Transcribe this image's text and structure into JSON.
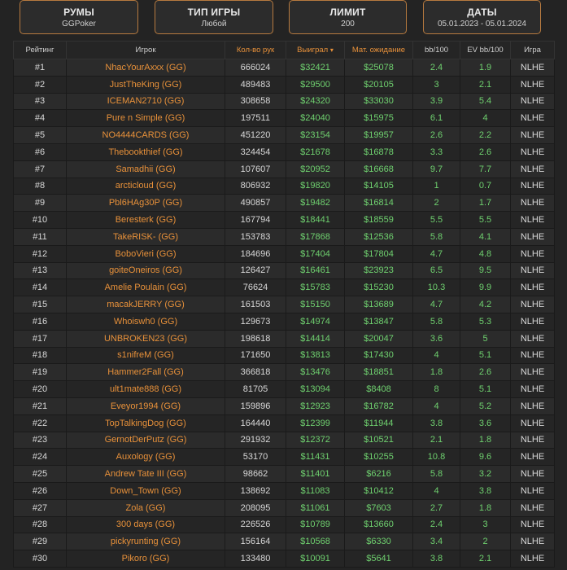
{
  "filters": [
    {
      "title": "РУМЫ",
      "value": "GGPoker"
    },
    {
      "title": "ТИП ИГРЫ",
      "value": "Любой"
    },
    {
      "title": "ЛИМИТ",
      "value": "200"
    },
    {
      "title": "ДАТЫ",
      "value": "05.01.2023 - 05.01.2024"
    }
  ],
  "table": {
    "headers": {
      "rank": "Рейтинг",
      "player": "Игрок",
      "hands": "Кол-во рук",
      "won": "Выиграл",
      "ev": "Мат. ожидание",
      "bb100": "bb/100",
      "evbb100": "EV bb/100",
      "game": "Игра"
    },
    "sort_icon": "▾",
    "rows": [
      {
        "rank": "#1",
        "player": "NhacYourAxxx (GG)",
        "hands": "666024",
        "won": "$32421",
        "ev": "$25078",
        "bb": "2.4",
        "evbb": "1.9",
        "game": "NLHE"
      },
      {
        "rank": "#2",
        "player": "JustTheKing (GG)",
        "hands": "489483",
        "won": "$29500",
        "ev": "$20105",
        "bb": "3",
        "evbb": "2.1",
        "game": "NLHE"
      },
      {
        "rank": "#3",
        "player": "ICEMAN2710 (GG)",
        "hands": "308658",
        "won": "$24320",
        "ev": "$33030",
        "bb": "3.9",
        "evbb": "5.4",
        "game": "NLHE"
      },
      {
        "rank": "#4",
        "player": "Pure n Simple (GG)",
        "hands": "197511",
        "won": "$24040",
        "ev": "$15975",
        "bb": "6.1",
        "evbb": "4",
        "game": "NLHE"
      },
      {
        "rank": "#5",
        "player": "NO4444CARDS (GG)",
        "hands": "451220",
        "won": "$23154",
        "ev": "$19957",
        "bb": "2.6",
        "evbb": "2.2",
        "game": "NLHE"
      },
      {
        "rank": "#6",
        "player": "Thebookthief (GG)",
        "hands": "324454",
        "won": "$21678",
        "ev": "$16878",
        "bb": "3.3",
        "evbb": "2.6",
        "game": "NLHE"
      },
      {
        "rank": "#7",
        "player": "Samadhii (GG)",
        "hands": "107607",
        "won": "$20952",
        "ev": "$16668",
        "bb": "9.7",
        "evbb": "7.7",
        "game": "NLHE"
      },
      {
        "rank": "#8",
        "player": "arcticloud (GG)",
        "hands": "806932",
        "won": "$19820",
        "ev": "$14105",
        "bb": "1",
        "evbb": "0.7",
        "game": "NLHE"
      },
      {
        "rank": "#9",
        "player": "Pbl6HAg30P (GG)",
        "hands": "490857",
        "won": "$19482",
        "ev": "$16814",
        "bb": "2",
        "evbb": "1.7",
        "game": "NLHE"
      },
      {
        "rank": "#10",
        "player": "Beresterk (GG)",
        "hands": "167794",
        "won": "$18441",
        "ev": "$18559",
        "bb": "5.5",
        "evbb": "5.5",
        "game": "NLHE"
      },
      {
        "rank": "#11",
        "player": "TakeRISK- (GG)",
        "hands": "153783",
        "won": "$17868",
        "ev": "$12536",
        "bb": "5.8",
        "evbb": "4.1",
        "game": "NLHE"
      },
      {
        "rank": "#12",
        "player": "BoboVieri (GG)",
        "hands": "184696",
        "won": "$17404",
        "ev": "$17804",
        "bb": "4.7",
        "evbb": "4.8",
        "game": "NLHE"
      },
      {
        "rank": "#13",
        "player": "goiteOneiros (GG)",
        "hands": "126427",
        "won": "$16461",
        "ev": "$23923",
        "bb": "6.5",
        "evbb": "9.5",
        "game": "NLHE"
      },
      {
        "rank": "#14",
        "player": "Amelie Poulain (GG)",
        "hands": "76624",
        "won": "$15783",
        "ev": "$15230",
        "bb": "10.3",
        "evbb": "9.9",
        "game": "NLHE"
      },
      {
        "rank": "#15",
        "player": "macakJERRY (GG)",
        "hands": "161503",
        "won": "$15150",
        "ev": "$13689",
        "bb": "4.7",
        "evbb": "4.2",
        "game": "NLHE"
      },
      {
        "rank": "#16",
        "player": "Whoiswh0 (GG)",
        "hands": "129673",
        "won": "$14974",
        "ev": "$13847",
        "bb": "5.8",
        "evbb": "5.3",
        "game": "NLHE"
      },
      {
        "rank": "#17",
        "player": "UNBROKEN23 (GG)",
        "hands": "198618",
        "won": "$14414",
        "ev": "$20047",
        "bb": "3.6",
        "evbb": "5",
        "game": "NLHE"
      },
      {
        "rank": "#18",
        "player": "s1nifreM (GG)",
        "hands": "171650",
        "won": "$13813",
        "ev": "$17430",
        "bb": "4",
        "evbb": "5.1",
        "game": "NLHE"
      },
      {
        "rank": "#19",
        "player": "Hammer2Fall (GG)",
        "hands": "366818",
        "won": "$13476",
        "ev": "$18851",
        "bb": "1.8",
        "evbb": "2.6",
        "game": "NLHE"
      },
      {
        "rank": "#20",
        "player": "ult1mate888 (GG)",
        "hands": "81705",
        "won": "$13094",
        "ev": "$8408",
        "bb": "8",
        "evbb": "5.1",
        "game": "NLHE"
      },
      {
        "rank": "#21",
        "player": "Eveyor1994 (GG)",
        "hands": "159896",
        "won": "$12923",
        "ev": "$16782",
        "bb": "4",
        "evbb": "5.2",
        "game": "NLHE"
      },
      {
        "rank": "#22",
        "player": "TopTalkingDog (GG)",
        "hands": "164440",
        "won": "$12399",
        "ev": "$11944",
        "bb": "3.8",
        "evbb": "3.6",
        "game": "NLHE"
      },
      {
        "rank": "#23",
        "player": "GernotDerPutz (GG)",
        "hands": "291932",
        "won": "$12372",
        "ev": "$10521",
        "bb": "2.1",
        "evbb": "1.8",
        "game": "NLHE"
      },
      {
        "rank": "#24",
        "player": "Auxology (GG)",
        "hands": "53170",
        "won": "$11431",
        "ev": "$10255",
        "bb": "10.8",
        "evbb": "9.6",
        "game": "NLHE"
      },
      {
        "rank": "#25",
        "player": "Andrew Tate III (GG)",
        "hands": "98662",
        "won": "$11401",
        "ev": "$6216",
        "bb": "5.8",
        "evbb": "3.2",
        "game": "NLHE"
      },
      {
        "rank": "#26",
        "player": "Down_Town (GG)",
        "hands": "138692",
        "won": "$11083",
        "ev": "$10412",
        "bb": "4",
        "evbb": "3.8",
        "game": "NLHE"
      },
      {
        "rank": "#27",
        "player": "Zola (GG)",
        "hands": "208095",
        "won": "$11061",
        "ev": "$7603",
        "bb": "2.7",
        "evbb": "1.8",
        "game": "NLHE"
      },
      {
        "rank": "#28",
        "player": "300 days (GG)",
        "hands": "226526",
        "won": "$10789",
        "ev": "$13660",
        "bb": "2.4",
        "evbb": "3",
        "game": "NLHE"
      },
      {
        "rank": "#29",
        "player": "pickyrunting (GG)",
        "hands": "156164",
        "won": "$10568",
        "ev": "$6330",
        "bb": "3.4",
        "evbb": "2",
        "game": "NLHE"
      },
      {
        "rank": "#30",
        "player": "Pikoro (GG)",
        "hands": "133480",
        "won": "$10091",
        "ev": "$5641",
        "bb": "3.8",
        "evbb": "2.1",
        "game": "NLHE"
      }
    ]
  },
  "colors": {
    "accent": "#e8913a",
    "positive": "#6fd16f",
    "border": "#b77a3f"
  }
}
